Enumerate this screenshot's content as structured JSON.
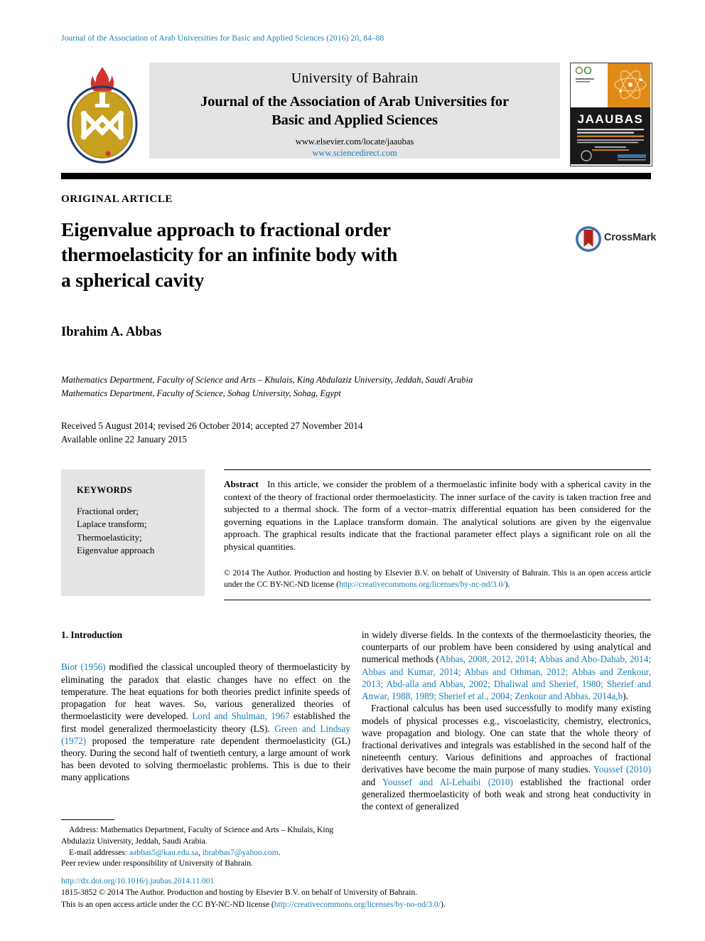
{
  "running_head": "Journal of the Association of Arab Universities for Basic and Applied Sciences (2016) 20, 84–88",
  "masthead": {
    "publisher": "University of Bahrain",
    "journal_title_line1": "Journal of the Association of Arab Universities for",
    "journal_title_line2": "Basic and Applied Sciences",
    "url_elsevier": "www.elsevier.com/locate/jaaubas",
    "url_sciencedirect": "www.sciencedirect.com",
    "logo_left_alt": "university-of-bahrain-logo",
    "cover_title": "JAAUBAS"
  },
  "article": {
    "kind": "ORIGINAL ARTICLE",
    "title_line1": "Eigenvalue approach to fractional order",
    "title_line2": "thermoelasticity for an infinite body with",
    "title_line3": "a spherical cavity",
    "crossmark_label": "CrossMark",
    "author": "Ibrahim A. Abbas",
    "affiliation_line1": "Mathematics Department, Faculty of Science and Arts – Khulais, King Abdulaziz University, Jeddah, Saudi Arabia",
    "affiliation_line2": "Mathematics Department, Faculty of Science, Sohag University, Sohag, Egypt",
    "received": "Received 5 August 2014; revised 26 October 2014; accepted 27 November 2014",
    "available_online": "Available online 22 January 2015"
  },
  "keywords": {
    "heading": "KEYWORDS",
    "items": [
      "Fractional order;",
      "Laplace transform;",
      "Thermoelasticity;",
      "Eigenvalue approach"
    ]
  },
  "abstract": {
    "label": "Abstract",
    "text": "In this article, we consider the problem of a thermoelastic infinite body with a spherical cavity in the context of the theory of fractional order thermoelasticity. The inner surface of the cavity is taken traction free and subjected to a thermal shock. The form of a vector–matrix differential equation has been considered for the governing equations in the Laplace transform domain. The analytical solutions are given by the eigenvalue approach. The graphical results indicate that the fractional parameter effect plays a significant role on all the physical quantities.",
    "copyright_pre": "© 2014 The Author. Production and hosting by Elsevier B.V. on behalf of University of Bahrain.  This is an open access article under the CC BY-NC-ND license (",
    "copyright_link": "http://creativecommons.org/licenses/by-nc-nd/3.0/",
    "copyright_post": ")."
  },
  "body": {
    "section_heading": "1. Introduction",
    "left_column": [
      {
        "segments": [
          {
            "text": "Biot (1956)",
            "style": "cite"
          },
          {
            "text": " modified the classical uncoupled theory of thermoelasticity by eliminating the paradox that elastic changes have no effect on the temperature. The heat equations for both theories predict infinite speeds of propagation for heat waves. So, various generalized theories of thermoelasticity were developed. ",
            "style": "plain"
          },
          {
            "text": "Lord and Shulman, 1967",
            "style": "cite"
          },
          {
            "text": " established the first model generalized thermoelasticity theory (LS). ",
            "style": "plain"
          },
          {
            "text": "Green and Lindsay (1972)",
            "style": "cite"
          },
          {
            "text": " proposed the temperature rate dependent thermoelasticity (GL) theory. During the second half of twentieth century, a large amount of work has been devoted to solving thermoelastic problems. This is due to their many applications",
            "style": "plain"
          }
        ]
      }
    ],
    "right_column": [
      {
        "segments": [
          {
            "text": "in widely diverse fields. In the contexts of the thermoelasticity theories, the counterparts of our problem have been considered by using analytical and numerical methods (",
            "style": "plain"
          },
          {
            "text": "Abbas, 2008, 2012, 2014; Abbas and Abo-Dahab, 2014; Abbas and Kumar, 2014; Abbas and Othman, 2012; Abbas and Zenkour, 2013; Abd-alla and Abbas, 2002; Dhaliwal and Sherief, 1980; Sherief and Anwar, 1988, 1989; Sherief et al., 2004; Zenkour and Abbas, 2014a,b",
            "style": "cite"
          },
          {
            "text": ").",
            "style": "plain"
          }
        ]
      },
      {
        "indent": true,
        "segments": [
          {
            "text": "Fractional calculus has been used successfully to modify many existing models of physical processes e.g., viscoelasticity, chemistry, electronics, wave propagation and biology. One can state that the whole theory of fractional derivatives and integrals was established in the second half of the nineteenth century. Various definitions and approaches of fractional derivatives have become the main purpose of many studies. ",
            "style": "plain"
          },
          {
            "text": "Youssef (2010)",
            "style": "cite"
          },
          {
            "text": " and ",
            "style": "plain"
          },
          {
            "text": "Youssef and Al-Lehaibi (2010)",
            "style": "cite"
          },
          {
            "text": " established the fractional order generalized thermoelasticity of both weak and strong heat conductivity in the context of generalized",
            "style": "plain"
          }
        ]
      }
    ]
  },
  "footnote": {
    "address_label": "Address:",
    "address_text": " Mathematics Department, Faculty of Science and Arts – Khulais, King Abdulaziz University, Jeddah, Saudi Arabia.",
    "email_label": "E-mail addresses:",
    "email1": "aabbas5@kau.edu.sa",
    "email_sep": ", ",
    "email2": "ibrabbas7@yahoo.com",
    "email_end": ".",
    "peer_review": "Peer review under responsibility of University of Bahrain."
  },
  "page_footer": {
    "doi": "http://dx.doi.org/10.1016/j.jaubas.2014.11.001",
    "issn_line": "1815-3852 © 2014 The Author. Production and hosting by Elsevier B.V. on behalf of University of Bahrain.",
    "license_pre": "This is an open access article under the CC BY-NC-ND license (",
    "license_link": "http://creativecommons.org/licenses/by-no-nd/3.0/",
    "license_post": ")."
  },
  "colors": {
    "link": "#1a7eb5",
    "banner_bg": "#e4e4e4",
    "rule": "#000000",
    "logo_gold": "#c8a020",
    "logo_red": "#d1342f",
    "cover_orange": "#e08a18",
    "crossmark_blue": "#3f6fa8",
    "crossmark_red": "#b02418"
  }
}
